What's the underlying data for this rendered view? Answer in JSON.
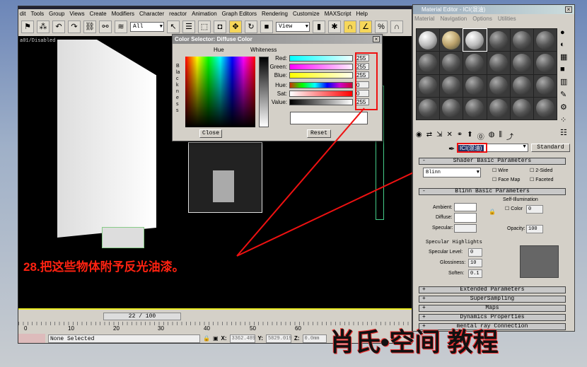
{
  "max": {
    "menu": [
      "dit",
      "Tools",
      "Group",
      "Views",
      "Create",
      "Modifiers",
      "Character",
      "reactor",
      "Animation",
      "Graph Editors",
      "Rendering",
      "Customize",
      "MAXScript",
      "Help"
    ],
    "selection_filter": "All",
    "ref_coord": "View",
    "viewport_label": "a01/Disabled",
    "timeline": {
      "frame": "22 / 100",
      "current": 22,
      "ticks": [
        "0",
        "10",
        "20",
        "30",
        "40",
        "50",
        "60"
      ]
    },
    "status": {
      "text": "None Selected",
      "x_label": "X:",
      "x": "3362.489",
      "y_label": "Y:",
      "y": "5829.019",
      "z_label": "Z:",
      "z": "0.0mm"
    }
  },
  "color_selector": {
    "title": "Color Selector: Diffuse Color",
    "hue_label": "Hue",
    "whiteness_label": "Whiteness",
    "blackness_label": "Blackness",
    "rows": [
      {
        "label": "Red:",
        "value": "255"
      },
      {
        "label": "Green:",
        "value": "255"
      },
      {
        "label": "Blue:",
        "value": "255"
      },
      {
        "label": "Hue:",
        "value": "0"
      },
      {
        "label": "Sat:",
        "value": "0"
      },
      {
        "label": "Value:",
        "value": "255"
      }
    ],
    "close": "Close",
    "reset": "Reset",
    "color": "#ffffff"
  },
  "material_editor": {
    "title": "Material Editor - ICI(混油)",
    "menu": [
      "Material",
      "Navigation",
      "Options",
      "Utilities"
    ],
    "material_name": "ICI(混油)",
    "type": "Standard",
    "shader_rollout": "Shader Basic Parameters",
    "shader": "Blinn",
    "checks": [
      "Wire",
      "2-Sided",
      "Face Map",
      "Faceted"
    ],
    "blinn_rollout": "Blinn Basic Parameters",
    "ambient": "Ambient:",
    "diffuse": "Diffuse:",
    "specular": "Specular:",
    "self_illum": "Self-Illumination",
    "color_label": "Color",
    "color_value": "0",
    "opacity_label": "Opacity:",
    "opacity": "100",
    "spec_group": "Specular Highlights",
    "spec_level_label": "Specular Level:",
    "spec_level": "0",
    "gloss_label": "Glossiness:",
    "gloss": "10",
    "soften_label": "Soften:",
    "soften": "0.1",
    "rollouts": [
      "Extended Parameters",
      "SuperSampling",
      "Maps",
      "Dynamics Properties",
      "mental ray Connection"
    ]
  },
  "caption": "28.把这些物体附予反光油漆。",
  "watermark": "肖氏•空间 教程"
}
